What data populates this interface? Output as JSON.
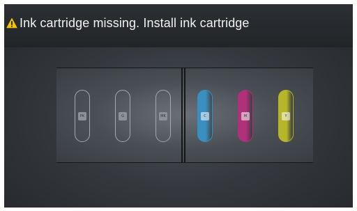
{
  "header": {
    "message": "Ink cartridge missing. Install ink cartridge",
    "icon": "warning-icon"
  },
  "cartridges": [
    {
      "label": "PK",
      "installed": false,
      "color": "#9aa0a6"
    },
    {
      "label": "G",
      "installed": false,
      "color": "#9aa0a6"
    },
    {
      "label": "MK",
      "installed": false,
      "color": "#9aa0a6"
    },
    {
      "label": "C",
      "installed": true,
      "color": "#3a8fc0"
    },
    {
      "label": "M",
      "installed": true,
      "color": "#b0307a"
    },
    {
      "label": "Y",
      "installed": true,
      "color": "#b7b52a"
    }
  ],
  "colors": {
    "warning": "#f4c300",
    "background": "#2a2d31"
  }
}
